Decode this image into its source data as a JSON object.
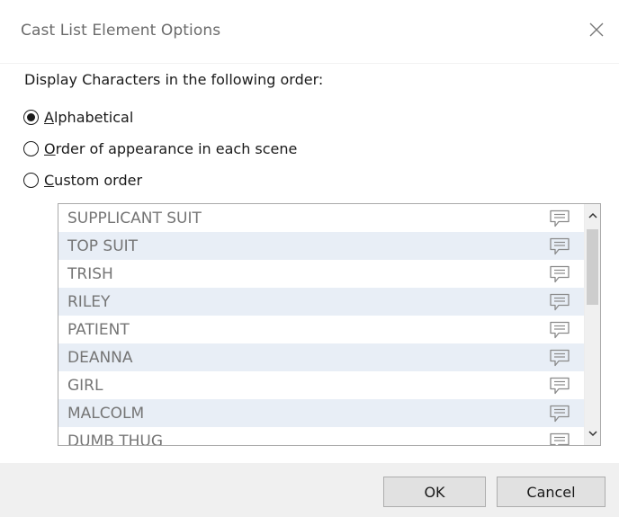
{
  "dialog": {
    "title": "Cast List Element Options",
    "close_icon": "close-icon"
  },
  "order_group": {
    "prompt": "Display Characters in the following order:",
    "options": [
      {
        "accel": "A",
        "rest": "lphabetical",
        "selected": true
      },
      {
        "accel": "O",
        "rest": "rder of appearance in each scene",
        "selected": false
      },
      {
        "accel": "C",
        "rest": "ustom order",
        "selected": false
      }
    ]
  },
  "character_list": {
    "items": [
      {
        "name": "SUPPLICANT SUIT",
        "icon": "comment-icon"
      },
      {
        "name": "TOP SUIT",
        "icon": "comment-icon"
      },
      {
        "name": "TRISH",
        "icon": "comment-icon"
      },
      {
        "name": "RILEY",
        "icon": "comment-icon"
      },
      {
        "name": "PATIENT",
        "icon": "comment-icon"
      },
      {
        "name": "DEANNA",
        "icon": "comment-icon"
      },
      {
        "name": "GIRL",
        "icon": "comment-icon"
      },
      {
        "name": "MALCOLM",
        "icon": "comment-icon"
      },
      {
        "name": "DUMB THUG",
        "icon": "comment-icon"
      }
    ],
    "scroll_up_icon": "chevron-up-icon",
    "scroll_down_icon": "chevron-down-icon"
  },
  "buttons": {
    "ok_label": "OK",
    "cancel_label": "Cancel"
  },
  "colors": {
    "row_alt_bg": "#e8eef6",
    "footer_bg": "#f0f0f0",
    "row_text": "#757575"
  }
}
